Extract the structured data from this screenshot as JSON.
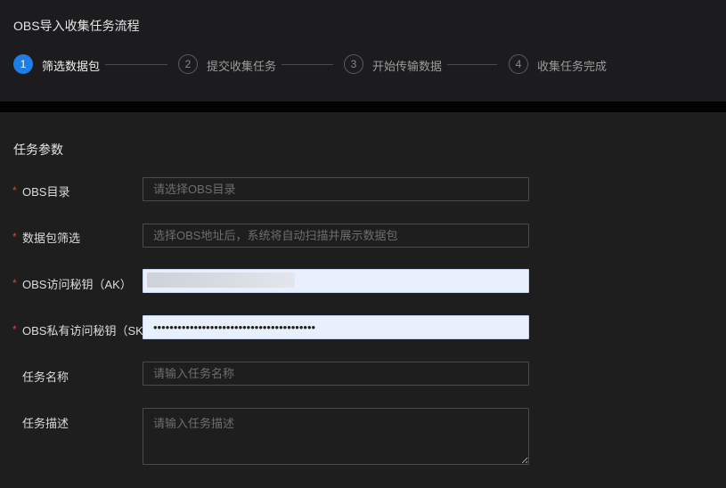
{
  "header": {
    "title": "OBS导入收集任务流程"
  },
  "steps": [
    {
      "number": "1",
      "label": "筛选数据包",
      "active": true
    },
    {
      "number": "2",
      "label": "提交收集任务",
      "active": false
    },
    {
      "number": "3",
      "label": "开始传输数据",
      "active": false
    },
    {
      "number": "4",
      "label": "收集任务完成",
      "active": false
    }
  ],
  "form": {
    "section_title": "任务参数",
    "required_mark": "*",
    "fields": [
      {
        "label": "OBS目录",
        "required": true,
        "placeholder": "请选择OBS目录",
        "value": ""
      },
      {
        "label": "数据包筛选",
        "required": true,
        "placeholder": "选择OBS地址后，系统将自动扫描并展示数据包",
        "value": ""
      },
      {
        "label": "OBS访问秘钥（AK）",
        "required": true,
        "placeholder": "",
        "value": ""
      },
      {
        "label": "OBS私有访问秘钥（SK）",
        "required": true,
        "placeholder": "",
        "value": "••••••••••••••••••••••••••••••••••••••••"
      },
      {
        "label": "任务名称",
        "required": false,
        "placeholder": "请输入任务名称",
        "value": ""
      },
      {
        "label": "任务描述",
        "required": false,
        "placeholder": "请输入任务描述",
        "value": ""
      }
    ]
  },
  "colors": {
    "accent": "#1f7ee6",
    "required": "#e0453a",
    "autofill_bg": "#e8f0fe"
  }
}
